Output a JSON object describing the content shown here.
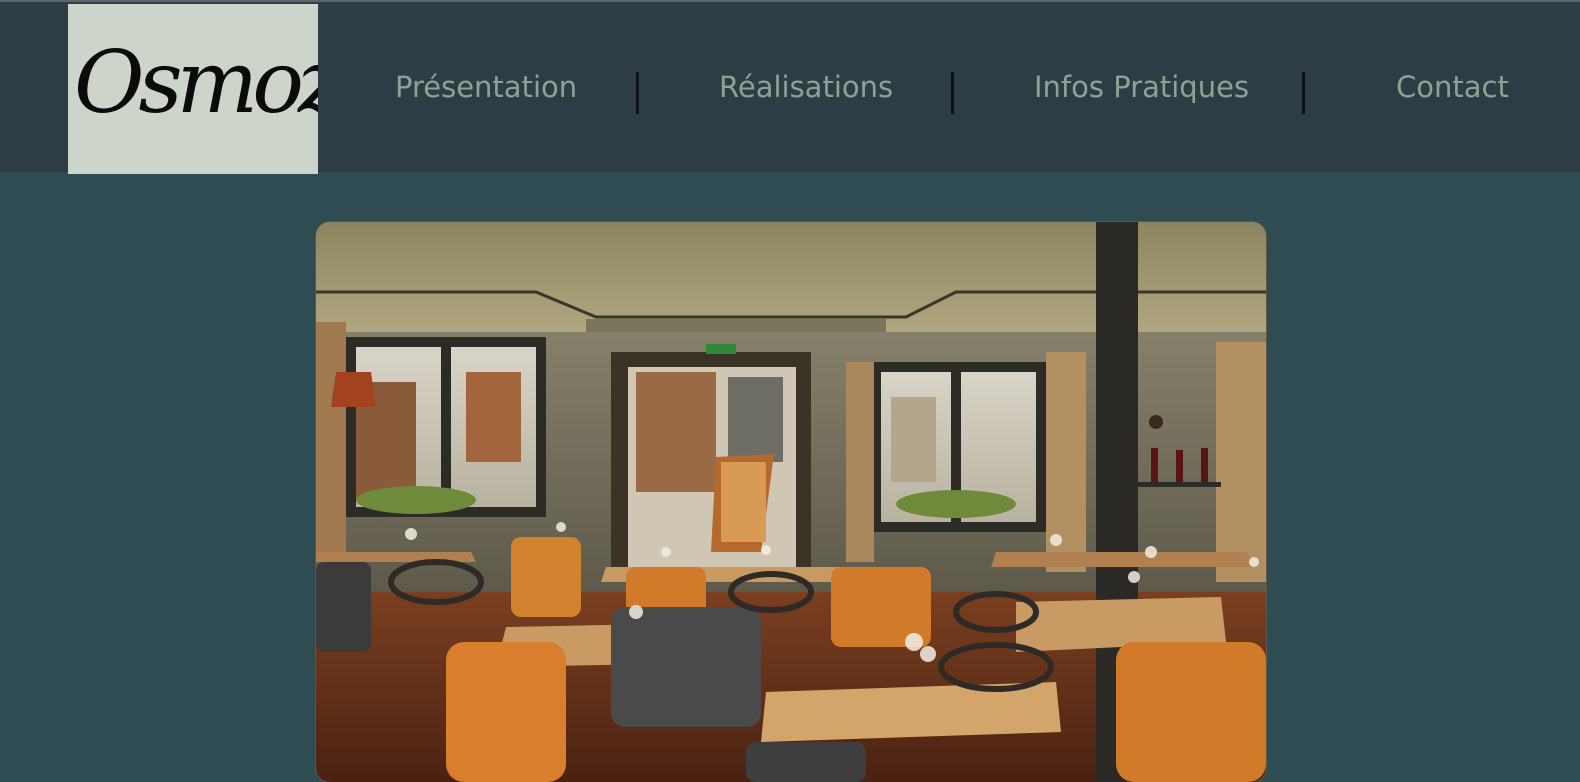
{
  "brand": {
    "logo_text": "Osmoz"
  },
  "nav": {
    "items": [
      {
        "label": "Présentation"
      },
      {
        "label": "Réalisations"
      },
      {
        "label": "Infos Pratiques"
      },
      {
        "label": "Contact"
      }
    ]
  },
  "hero": {
    "image": "restaurant-dining-room-photo"
  },
  "colors": {
    "header_bg": "#2e3c46",
    "page_bg": "#2f4c53",
    "logo_bg": "#cdd5cb",
    "nav_text": "#8aa392"
  }
}
